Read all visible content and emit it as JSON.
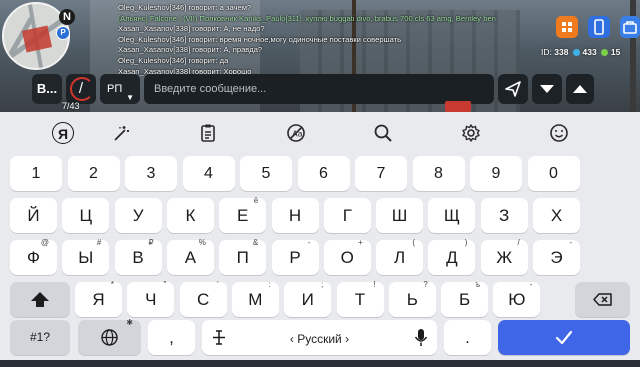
{
  "chat": {
    "lines": [
      {
        "text": "Oleg_Kuleshov[346] говорит: а зачем?",
        "alliance": false
      },
      {
        "text": "[Альянс] Falcone | (VII) Полковник Kaniks_Paulo[311]: куплю buggati divo, brabus 700,cls 63 amg, Bentley ben",
        "alliance": true
      },
      {
        "text": "Xasan_Xasanov[338] говорит: А, не надо?",
        "alliance": false
      },
      {
        "text": "Oleg_Kuleshov[346] говорит: время ночное,могу одиночные поставки совершать",
        "alliance": false
      },
      {
        "text": "Xasan_Xasanov[338] говорит: А, правда?",
        "alliance": false
      },
      {
        "text": "Oleg_Kuleshov[346] говорит: да",
        "alliance": false
      },
      {
        "text": "Xasan_Xasanov[338] говорит: Хорошо",
        "alliance": false
      }
    ]
  },
  "minimap": {
    "north_label": "N",
    "marker_label": "P"
  },
  "hud": {
    "id_label": "ID:",
    "id_value": "338",
    "stat2": "433",
    "stat3": "15",
    "hp_text": "7/43"
  },
  "input": {
    "voice_label": "B...",
    "slash_label": "/",
    "mode_label": "РП",
    "mode_caret": "▼",
    "placeholder": "Введите сообщение..."
  },
  "keyboard": {
    "toolbar_icons": [
      "yandex-logo-icon",
      "magic-wand-icon",
      "clipboard-icon",
      "no-translate-icon",
      "search-icon",
      "settings-gear-icon",
      "emoji-icon"
    ],
    "yandex_letter": "Я",
    "row_numbers": [
      "1",
      "2",
      "3",
      "4",
      "5",
      "6",
      "7",
      "8",
      "9",
      "0"
    ],
    "row1": [
      {
        "k": "й",
        "s": ""
      },
      {
        "k": "ц",
        "s": ""
      },
      {
        "k": "у",
        "s": ""
      },
      {
        "k": "к",
        "s": ""
      },
      {
        "k": "е",
        "s": "ё"
      },
      {
        "k": "н",
        "s": ""
      },
      {
        "k": "г",
        "s": ""
      },
      {
        "k": "ш",
        "s": ""
      },
      {
        "k": "щ",
        "s": ""
      },
      {
        "k": "з",
        "s": ""
      },
      {
        "k": "х",
        "s": ""
      }
    ],
    "row2": [
      {
        "k": "ф",
        "s": "@"
      },
      {
        "k": "ы",
        "s": "#"
      },
      {
        "k": "в",
        "s": "₽"
      },
      {
        "k": "а",
        "s": "%"
      },
      {
        "k": "п",
        "s": "&"
      },
      {
        "k": "р",
        "s": "-"
      },
      {
        "k": "о",
        "s": "+"
      },
      {
        "k": "л",
        "s": "("
      },
      {
        "k": "д",
        "s": ")"
      },
      {
        "k": "ж",
        "s": "/"
      },
      {
        "k": "э",
        "s": "-"
      }
    ],
    "row3": [
      {
        "k": "я",
        "s": "*"
      },
      {
        "k": "ч",
        "s": "\""
      },
      {
        "k": "с",
        "s": "'"
      },
      {
        "k": "м",
        "s": ":"
      },
      {
        "k": "и",
        "s": ";"
      },
      {
        "k": "т",
        "s": "!"
      },
      {
        "k": "ь",
        "s": "?"
      },
      {
        "k": "б",
        "s": "ъ"
      },
      {
        "k": "ю",
        "s": "-"
      }
    ],
    "sym_label": "#1?",
    "comma_label": ",",
    "period_label": ".",
    "space_label": "‹ Русский ›",
    "globe_sup": "✱"
  }
}
